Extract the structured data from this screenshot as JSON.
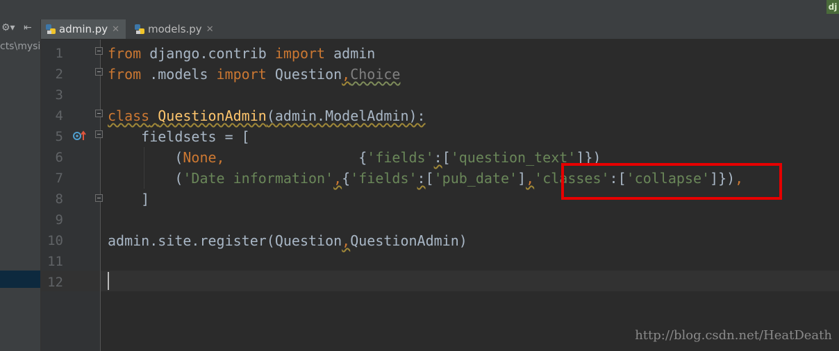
{
  "window": {
    "corner_badge": "dj"
  },
  "project_panel": {
    "path_fragment": "cts\\mysi",
    "tools": [
      "settings-gear-icon",
      "collapse-panel-icon"
    ]
  },
  "tabs": [
    {
      "label": "admin.py",
      "active": true
    },
    {
      "label": "models.py",
      "active": false
    }
  ],
  "editor": {
    "line_numbers": [
      "1",
      "2",
      "3",
      "4",
      "5",
      "6",
      "7",
      "8",
      "9",
      "10",
      "11",
      "12"
    ],
    "lines": {
      "l1": {
        "kw1": "from",
        "t1": " django.contrib ",
        "kw2": "import",
        "t2": " admin"
      },
      "l2": {
        "kw1": "from",
        "t1": " .models ",
        "kw2": "import",
        "t2": " Question",
        "c1": ",",
        "t3": "Choice"
      },
      "l4": {
        "kw1": "class",
        "t1": " ",
        "name": "QuestionAdmin",
        "t2": "(admin.ModelAdmin):"
      },
      "l5": {
        "t1": "    fieldsets = ["
      },
      "l6": {
        "t1": "        (",
        "none": "None",
        "c1": ",",
        "pad": "                ",
        "b1": "{",
        "s1": "'fields'",
        "c2": ":",
        "b2": "[",
        "s2": "'question_text'",
        "b3": "]})"
      },
      "l7": {
        "t1": "        (",
        "s1": "'Date information'",
        "c1": ",",
        "b1": "{",
        "s2": "'fields'",
        "c2": ":",
        "b2": "[",
        "s3": "'pub_date'",
        "b3": "]",
        "c3": ",",
        "s4": "'classes'",
        "c4": ":",
        "b4": "[",
        "s5": "'collapse'",
        "b5": "]})",
        "c5": ","
      },
      "l8": {
        "t1": "    ]"
      },
      "l10": {
        "t1": "admin.site.register(Question",
        "c1": ",",
        "t2": "QuestionAdmin)"
      }
    }
  },
  "watermark": "http://blog.csdn.net/HeatDeath",
  "colors": {
    "keyword": "#cc7832",
    "string": "#6a8759",
    "class_name": "#ffc66d",
    "default_text": "#a9b7c6",
    "highlight_box": "#e60000"
  }
}
